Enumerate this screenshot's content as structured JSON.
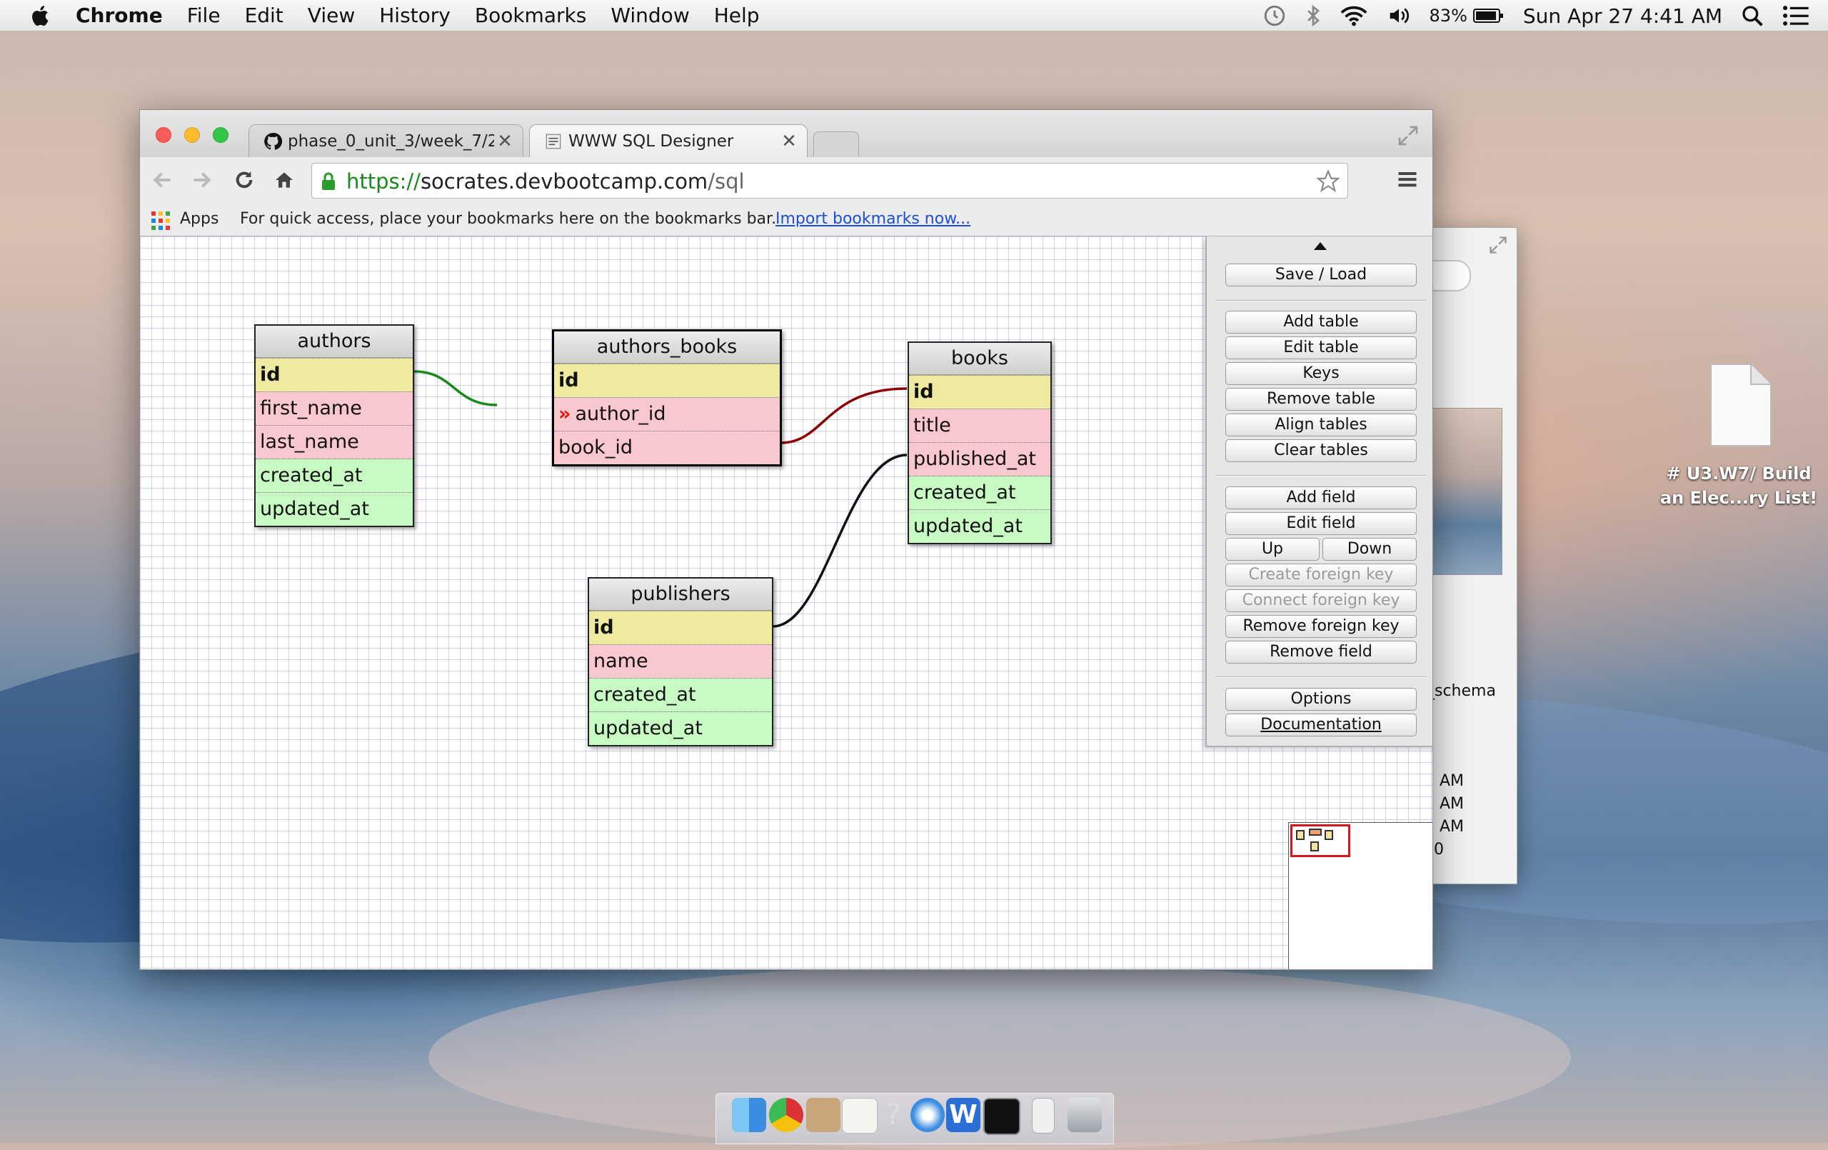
{
  "menubar": {
    "app_name": "Chrome",
    "items": [
      "File",
      "Edit",
      "View",
      "History",
      "Bookmarks",
      "Window",
      "Help"
    ],
    "battery": "83%",
    "clock": "Sun Apr 27  4:41 AM"
  },
  "browser": {
    "tabs": [
      {
        "title": "phase_0_unit_3/week_7/2",
        "active": false
      },
      {
        "title": "WWW SQL Designer",
        "active": true
      }
    ],
    "url": {
      "scheme": "https://",
      "host": "socrates.devbootcamp.com",
      "path": "/sql"
    },
    "bookmarks_bar": {
      "apps_label": "Apps",
      "hint": "For quick access, place your bookmarks here on the bookmarks bar.",
      "import_link": "Import bookmarks now..."
    }
  },
  "diagram": {
    "tables": [
      {
        "name": "authors",
        "fields": [
          {
            "name": "id",
            "kind": "pk"
          },
          {
            "name": "first_name",
            "kind": "string"
          },
          {
            "name": "last_name",
            "kind": "string"
          },
          {
            "name": "created_at",
            "kind": "datetime"
          },
          {
            "name": "updated_at",
            "kind": "datetime"
          }
        ]
      },
      {
        "name": "authors_books",
        "selected": true,
        "fields": [
          {
            "name": "id",
            "kind": "pk"
          },
          {
            "name": "author_id",
            "kind": "string",
            "fk_marker": "»"
          },
          {
            "name": "book_id",
            "kind": "string"
          }
        ]
      },
      {
        "name": "books",
        "fields": [
          {
            "name": "id",
            "kind": "pk"
          },
          {
            "name": "title",
            "kind": "string"
          },
          {
            "name": "published_at",
            "kind": "string"
          },
          {
            "name": "created_at",
            "kind": "datetime"
          },
          {
            "name": "updated_at",
            "kind": "datetime"
          }
        ]
      },
      {
        "name": "publishers",
        "fields": [
          {
            "name": "id",
            "kind": "pk"
          },
          {
            "name": "name",
            "kind": "string"
          },
          {
            "name": "created_at",
            "kind": "datetime"
          },
          {
            "name": "updated_at",
            "kind": "datetime"
          }
        ]
      }
    ],
    "relations": [
      {
        "from": "authors.id",
        "to": "authors_books.author_id",
        "color": "#1a8a1a"
      },
      {
        "from": "books.id",
        "to": "authors_books.book_id",
        "color": "#8b0000"
      },
      {
        "from": "publishers.id",
        "to": "books.published_at",
        "color": "#111111"
      }
    ],
    "colors": {
      "pk": "#eeeaa0",
      "string": "#f9c8ce",
      "datetime": "#c8fbc4"
    }
  },
  "panel": {
    "save_load": "Save / Load",
    "add_table": "Add table",
    "edit_table": "Edit table",
    "keys": "Keys",
    "remove_table": "Remove table",
    "align_tables": "Align tables",
    "clear_tables": "Clear tables",
    "add_field": "Add field",
    "edit_field": "Edit field",
    "up": "Up",
    "down": "Down",
    "create_foreign_key": "Create foreign key",
    "connect_foreign_key": "Connect foreign key",
    "remove_foreign_key": "Remove foreign key",
    "remove_field": "Remove field",
    "options": "Options",
    "documentation": "Documentation"
  },
  "desktop": {
    "file_label_line1": "# U3.W7/ Build",
    "file_label_line2": "an Elec...ry List!"
  },
  "background_window": {
    "schema_text": "_schema",
    "times": [
      "AM",
      "AM",
      "AM",
      "0"
    ]
  }
}
